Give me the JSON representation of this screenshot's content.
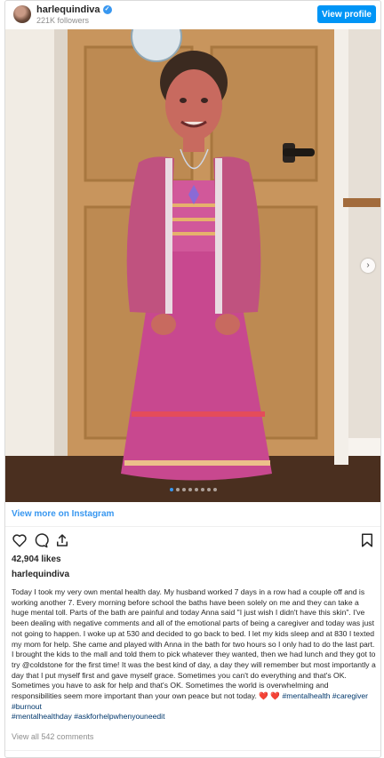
{
  "header": {
    "username": "harlequindiva",
    "followers": "221K followers",
    "view_profile": "View profile"
  },
  "post": {
    "slide_count": 8,
    "active_slide": 1
  },
  "view_more": "View more on Instagram",
  "likes": "42,904 likes",
  "caption": {
    "username": "harlequindiva",
    "text": "Today I took my very own mental health day. My husband worked 7 days in a row had a couple off and is working another 7. Every morning before school the baths have been solely on me and they can take a huge mental toll. Parts of the bath are painful and today Anna said \"I just wish I didn't have this skin\". I've been dealing with negative comments and all of the emotional parts of being a caregiver and today was just not going to happen. I woke up at 530 and decided to go back to bed. I let my kids sleep and at 830 I texted my mom for help. She came and played with Anna in the bath for two hours so I only had to do the last part. I brought the kids to the mall and told them to pick whatever they wanted, then we had lunch and they got to try @coldstone for the first time! It was the best kind of day, a day they will remember but most importantly a day that I put myself first and gave myself grace. Sometimes you can't do everything and that's OK. Sometimes you have to ask for help and that's OK. Sometimes the world is overwhelming and responsibilities seem more important than your own peace but not today.",
    "hearts": "❤️ ❤️",
    "tags_line1": "#mentalhealth #caregiver #burnout",
    "tags_line2": "#mentalhealthday #askforhelpwhenyouneedit"
  },
  "comments_link": "View all 542 comments",
  "icons": {
    "like": "heart-icon",
    "comment": "comment-icon",
    "share": "share-icon",
    "save": "bookmark-icon",
    "next": "chevron-right-icon"
  },
  "colors": {
    "accent": "#0095f6",
    "link": "#3897f0",
    "hashtag": "#00376b"
  }
}
